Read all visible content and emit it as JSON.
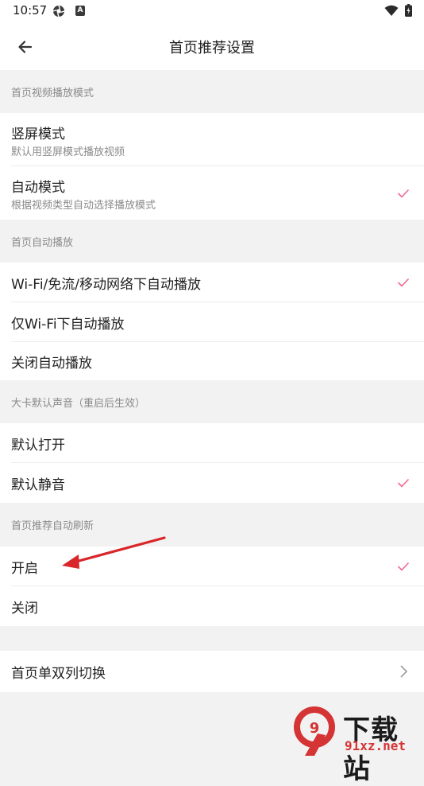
{
  "status_bar": {
    "time": "10:57",
    "icons": [
      "aperture-icon",
      "a-badge-icon",
      "wifi-icon",
      "battery-charging-icon"
    ],
    "badge_letter": "A"
  },
  "app_bar": {
    "back_icon": "arrow-left-icon",
    "title": "首页推荐设置"
  },
  "sections": [
    {
      "header": "首页视频播放模式",
      "options": [
        {
          "title": "竖屏模式",
          "subtitle": "默认用竖屏模式播放视频",
          "selected": false
        },
        {
          "title": "自动模式",
          "subtitle": "根据视频类型自动选择播放模式",
          "selected": true
        }
      ]
    },
    {
      "header": "首页自动播放",
      "options": [
        {
          "title": "Wi-Fi/免流/移动网络下自动播放",
          "selected": true
        },
        {
          "title": "仅Wi-Fi下自动播放",
          "selected": false
        },
        {
          "title": "关闭自动播放",
          "selected": false
        }
      ]
    },
    {
      "header": "大卡默认声音（重启后生效）",
      "options": [
        {
          "title": "默认打开",
          "selected": false
        },
        {
          "title": "默认静音",
          "selected": true
        }
      ]
    },
    {
      "header": "首页推荐自动刷新",
      "options": [
        {
          "title": "开启",
          "selected": true
        },
        {
          "title": "关闭",
          "selected": false
        }
      ]
    }
  ],
  "nav_row": {
    "title": "首页单双列切换",
    "icon": "chevron-right-icon"
  },
  "annotation": {
    "icon": "red-arrow-icon",
    "color": "#d9262a"
  },
  "watermark": {
    "logo_glyph": "9",
    "text_main": "下载站",
    "text_domain": "91xz.net",
    "color": "#d53434"
  },
  "colors": {
    "accent_check": "#f0698f",
    "section_bg": "#f2f2f2",
    "row_bg": "#ffffff"
  }
}
